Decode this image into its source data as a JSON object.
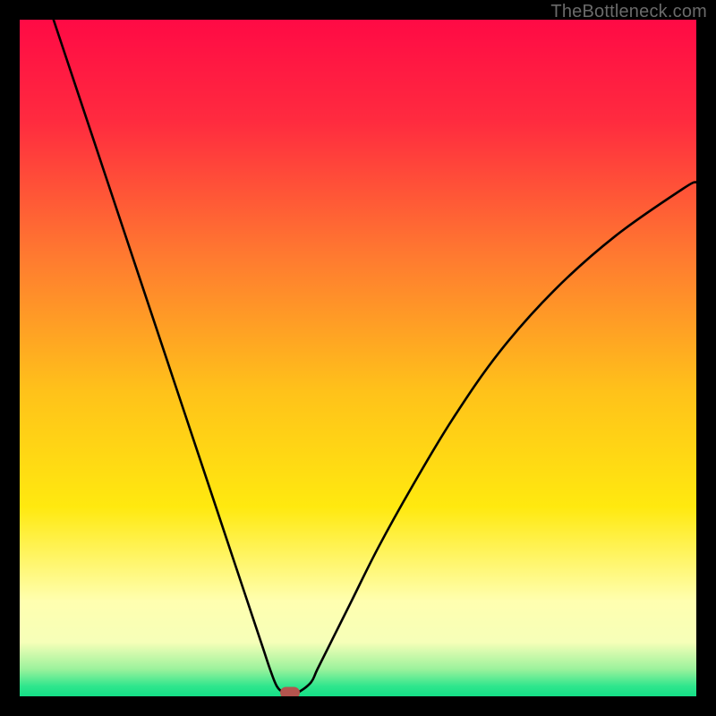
{
  "watermark": "TheBottleneck.com",
  "colors": {
    "frame": "#000000",
    "gradient_stops": [
      {
        "pos": 0.0,
        "color": "#ff0a45"
      },
      {
        "pos": 0.15,
        "color": "#ff2b3f"
      },
      {
        "pos": 0.35,
        "color": "#ff7a30"
      },
      {
        "pos": 0.55,
        "color": "#ffc21a"
      },
      {
        "pos": 0.72,
        "color": "#ffe90f"
      },
      {
        "pos": 0.86,
        "color": "#ffffb0"
      },
      {
        "pos": 0.92,
        "color": "#f6ffb8"
      },
      {
        "pos": 0.96,
        "color": "#9bf29c"
      },
      {
        "pos": 0.985,
        "color": "#2fe68d"
      },
      {
        "pos": 1.0,
        "color": "#14df86"
      }
    ],
    "curve": "#000000",
    "marker": "#b4544e"
  },
  "chart_data": {
    "type": "line",
    "title": "",
    "xlabel": "",
    "ylabel": "",
    "xlim": [
      0,
      100
    ],
    "ylim": [
      0,
      100
    ],
    "grid": false,
    "legend": false,
    "series": [
      {
        "name": "curve",
        "x": [
          5,
          8,
          11,
          14,
          17,
          20,
          23,
          26,
          29,
          32,
          34,
          36,
          37,
          38,
          39,
          40,
          41,
          43,
          44,
          46,
          49,
          53,
          58,
          64,
          71,
          79,
          88,
          98,
          100
        ],
        "y": [
          100,
          91,
          82,
          73,
          64,
          55,
          46,
          37,
          28,
          19,
          13,
          7,
          4,
          1.5,
          0.6,
          0.5,
          0.5,
          2,
          4,
          8,
          14,
          22,
          31,
          41,
          51,
          60,
          68,
          75,
          76
        ]
      }
    ],
    "flat_segment": {
      "x_start": 37.5,
      "x_end": 41.5,
      "y": 0.5
    },
    "marker": {
      "x": 40,
      "y": 0.5
    }
  }
}
